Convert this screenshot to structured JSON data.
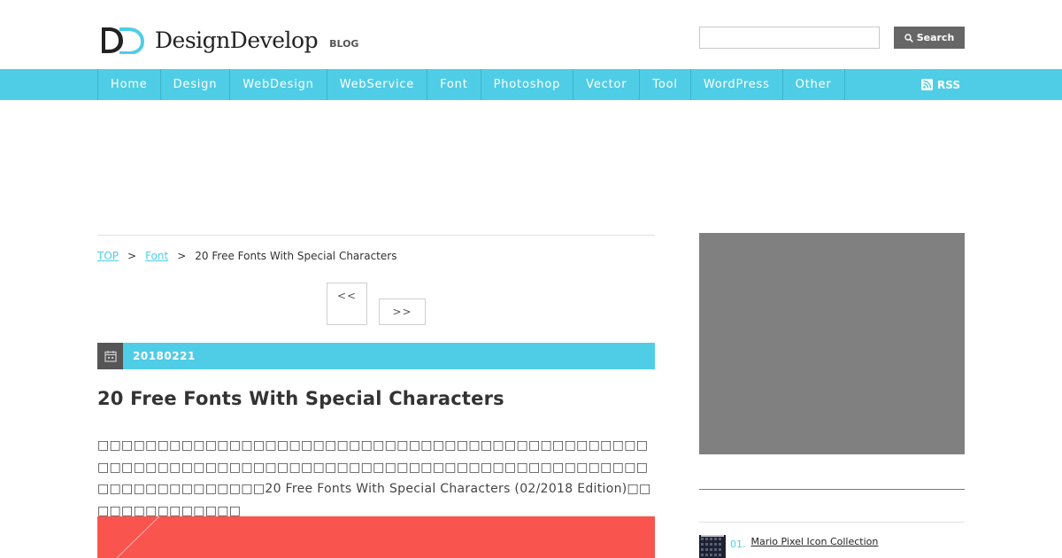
{
  "header": {
    "logo_text": "DesignDevelop",
    "logo_sub": "BLOG",
    "search": {
      "placeholder": "",
      "value": "",
      "button_label": "Search"
    }
  },
  "nav": {
    "items": [
      "Home",
      "Design",
      "WebDesign",
      "WebService",
      "Font",
      "Photoshop",
      "Vector",
      "Tool",
      "WordPress",
      "Other"
    ],
    "rss_label": "RSS"
  },
  "breadcrumb": {
    "top": "TOP",
    "sep": ">",
    "category": "Font",
    "current": "20 Free Fonts With Special Characters"
  },
  "pager": {
    "prev": "<<",
    "next": ">>"
  },
  "post": {
    "date": "20180221",
    "title": "20 Free Fonts With Special Characters",
    "excerpt": "□□□□□□□□□□□□□□□□□□□□□□□□□□□□□□□□□□□□□□□□□□□□□□□□□□□□□□□□□□□□□□□□□□□□□□□□□□□□□□□□□□□□□□□□□□□□□□□□□□□□□□□□□□20 Free Fonts With Special Characters (02/2018 Edition)□□□□□□□□□□□□□□"
  },
  "sidebar": {
    "ranking": [
      {
        "num": "01.",
        "title": "Mario Pixel Icon Collection"
      }
    ]
  },
  "colors": {
    "accent": "#4fcde6",
    "dark": "#555555",
    "ad": "#808080",
    "image": "#f9544d"
  }
}
